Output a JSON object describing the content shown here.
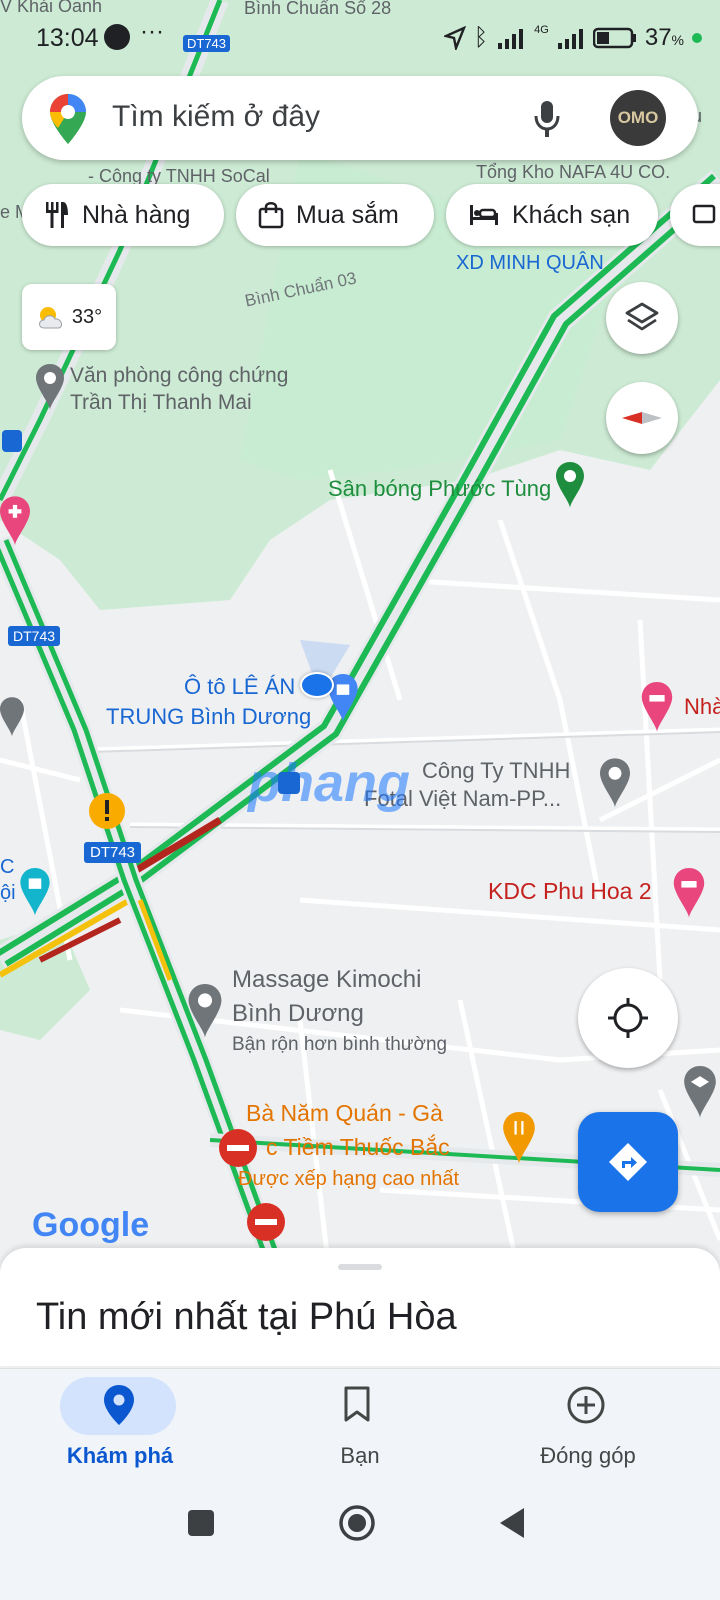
{
  "status_bar": {
    "time": "13:04",
    "dots": "···",
    "battery": "37",
    "battery_unit": "%",
    "network": "4G"
  },
  "search": {
    "placeholder": "Tìm kiếm ở đây",
    "avatar_text": "OMO"
  },
  "chips": [
    {
      "label": "Nhà hàng",
      "icon": "restaurant-icon"
    },
    {
      "label": "Mua sắm",
      "icon": "shopping-bag-icon"
    },
    {
      "label": "Khách sạn",
      "icon": "hotel-icon"
    }
  ],
  "weather": {
    "temp": "33°",
    "icon": "partly-cloudy-icon"
  },
  "map_labels": {
    "top_left": "V Khải Oanh",
    "top_center": "Bình Chuẩn Số 28",
    "dt743_a": "DT743",
    "dt743_b": "DT743",
    "dt743_c": "DT743",
    "socal": "- Công ty TNHH SoCal",
    "nafa": "Tổng Kho NAFA 4U CO.",
    "xd_minh_quan": "XD MINH QUÂN",
    "binh_chuan_03": "Bình Chuẩn 03",
    "notary_1": "Văn phòng công chứng",
    "notary_2": "Trần Thị Thanh Mai",
    "stadium": "Sân bóng Phước Tùng",
    "oto_1": "Ô tô LÊ ÁN",
    "oto_2": "TRUNG Bình Dương",
    "nha": "Nhà",
    "cong_ty_1": "Công Ty TNHH",
    "cong_ty_2": "Fotal Việt Nam-PP...",
    "kdc": "KDC Phu Hoa 2",
    "massage_1": "Massage Kimochi",
    "massage_2": "Bình Dương",
    "massage_3": "Bận rộn hơn bình thường",
    "ba_nam_1": "Bà Năm Quán - Gà",
    "ba_nam_2": "c Tiềm Thuốc Bắc",
    "ba_nam_3": "Được xếp hạng cao nhất",
    "c_left_1": "C",
    "c_left_2": "ội",
    "e_m": "e M",
    "u_right": "ều",
    "watermark": "phang",
    "google": "Google"
  },
  "sheet": {
    "title": "Tin mới nhất tại Phú Hòa"
  },
  "nav": [
    {
      "label": "Khám phá",
      "icon": "location-pin-icon",
      "active": true
    },
    {
      "label": "Bạn",
      "icon": "bookmark-icon",
      "active": false
    },
    {
      "label": "Đóng góp",
      "icon": "add-circle-icon",
      "active": false
    }
  ],
  "colors": {
    "accent": "#0b57d0",
    "traffic_green": "#1db954",
    "traffic_red": "#b3261e",
    "traffic_yellow": "#f4c20d",
    "park_green": "#c9efd2",
    "directions_fab": "#1a73e8"
  }
}
